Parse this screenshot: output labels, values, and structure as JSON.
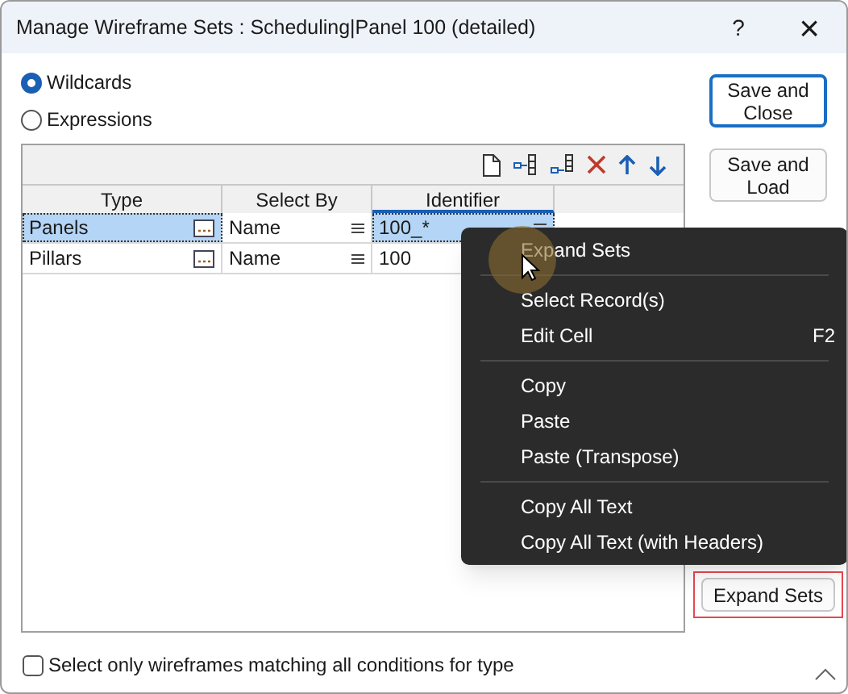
{
  "window": {
    "title": "Manage Wireframe Sets : Scheduling|Panel 100 (detailed)",
    "help": "?",
    "close": "×"
  },
  "modes": [
    {
      "label": "Wildcards",
      "selected": true
    },
    {
      "label": "Expressions",
      "selected": false
    }
  ],
  "table": {
    "columns": [
      "Type",
      "Select By",
      "Identifier"
    ],
    "rows": [
      {
        "type": "Panels",
        "select_by": "Name",
        "identifier": "100_*",
        "selected": true
      },
      {
        "type": "Pillars",
        "select_by": "Name",
        "identifier": "100",
        "selected": false
      }
    ]
  },
  "buttons": [
    {
      "label": "Save and Close",
      "default": true
    },
    {
      "label": "Save and Load",
      "default": false
    }
  ],
  "expand_button": {
    "label": "Expand Sets",
    "highlighted": true
  },
  "context_menu": [
    {
      "items": [
        {
          "label": "Expand Sets"
        }
      ]
    },
    {
      "items": [
        {
          "label": "Select Record(s)"
        },
        {
          "label": "Edit Cell",
          "shortcut": "F2"
        }
      ]
    },
    {
      "items": [
        {
          "label": "Copy"
        },
        {
          "label": "Paste"
        },
        {
          "label": "Paste (Transpose)"
        }
      ]
    },
    {
      "items": [
        {
          "label": "Copy All Text"
        },
        {
          "label": "Copy All Text (with Headers)"
        }
      ]
    }
  ],
  "match_all": {
    "label": "Select only wireframes matching all conditions for type",
    "checked": false
  }
}
